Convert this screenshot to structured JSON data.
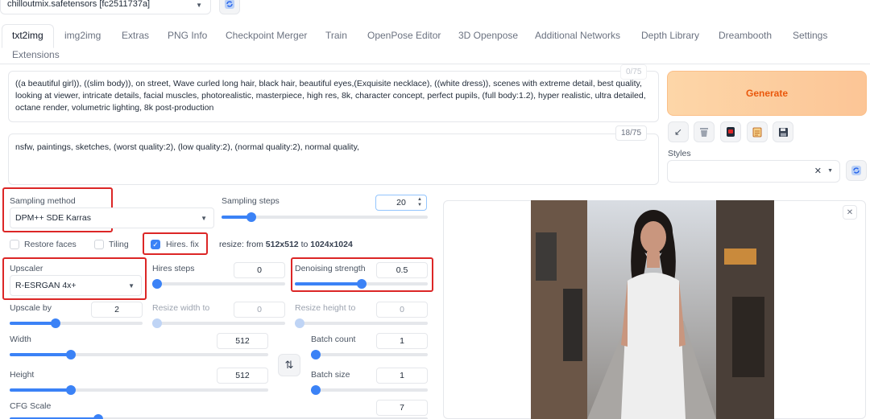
{
  "model": {
    "value": "chilloutmix.safetensors [fc2511737a]"
  },
  "tabs": [
    "txt2img",
    "img2img",
    "Extras",
    "PNG Info",
    "Checkpoint Merger",
    "Train",
    "OpenPose Editor",
    "3D Openpose",
    "Additional Networks",
    "Depth Library",
    "Dreambooth",
    "Settings",
    "Extensions"
  ],
  "prompt": {
    "text": "((a beautiful girl)), ((slim body)), on street, Wave curled long hair, black hair, beautiful eyes,(Exquisite necklace), ((white dress)), scenes with extreme detail, best quality, looking at viewer,  intricate details,  facial muscles, photorealistic, masterpiece, high res, 8k, character concept,  perfect pupils, (full body:1.2), hyper realistic, ultra detailed, octane render, volumetric lighting, 8k post-production",
    "token_count": "0/75"
  },
  "negative_prompt": {
    "text": "nsfw, paintings, sketches, (worst quality:2), (low quality:2), (normal quality:2), normal quality,",
    "token_count": "18/75"
  },
  "generate_label": "Generate",
  "styles": {
    "label": "Styles",
    "value": ""
  },
  "sampling": {
    "method_label": "Sampling method",
    "method_value": "DPM++ SDE Karras",
    "steps_label": "Sampling steps",
    "steps_value": "20"
  },
  "options": {
    "restore_faces": "Restore faces",
    "tiling": "Tiling",
    "hires_fix": "Hires. fix",
    "resize_prefix": "resize: from ",
    "resize_from": "512x512",
    "resize_to_word": " to ",
    "resize_to": "1024x1024"
  },
  "hires": {
    "upscaler_label": "Upscaler",
    "upscaler_value": "R-ESRGAN 4x+",
    "steps_label": "Hires steps",
    "steps_value": "0",
    "denoise_label": "Denoising strength",
    "denoise_value": "0.5",
    "upscale_by_label": "Upscale by",
    "upscale_by_value": "2",
    "resize_width_label": "Resize width to",
    "resize_width_value": "0",
    "resize_height_label": "Resize height to",
    "resize_height_value": "0"
  },
  "size": {
    "width_label": "Width",
    "width_value": "512",
    "height_label": "Height",
    "height_value": "512"
  },
  "batch": {
    "count_label": "Batch count",
    "count_value": "1",
    "size_label": "Batch size",
    "size_value": "1"
  },
  "cfg": {
    "label": "CFG Scale",
    "value": "7"
  },
  "colors": {
    "accent": "#3b82f6",
    "generate_text": "#ea580c",
    "highlight": "#dc2626"
  }
}
